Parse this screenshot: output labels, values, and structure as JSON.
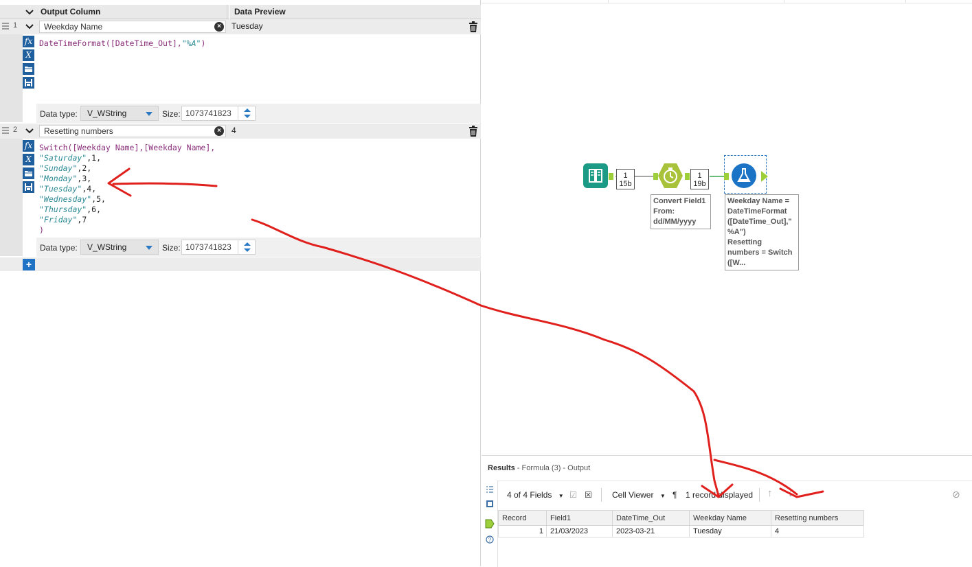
{
  "formula_panel": {
    "headers": {
      "output_column": "Output Column",
      "data_preview": "Data Preview"
    },
    "expressions": [
      {
        "index": "1",
        "name": "Weekday Name",
        "preview": "Tuesday",
        "code": [
          [
            [
              "fn",
              "DateTimeFormat("
            ],
            [
              "fn",
              "[DateTime_Out]"
            ],
            [
              "fn",
              ","
            ],
            [
              "str",
              "\"%A\""
            ],
            [
              "fn",
              ")"
            ]
          ]
        ],
        "data_type_label": "Data type:",
        "data_type": "V_WString",
        "size_label": "Size:",
        "size": "1073741823"
      },
      {
        "index": "2",
        "name": "Resetting numbers",
        "preview": "4",
        "code": [
          [
            [
              "fn",
              "Switch("
            ],
            [
              "fn",
              "[Weekday Name]"
            ],
            [
              "fn",
              ","
            ],
            [
              "fn",
              "[Weekday Name]"
            ],
            [
              "fn",
              ","
            ]
          ],
          [
            [
              "str",
              "\"Saturday\""
            ],
            [
              "txt",
              ",1,"
            ]
          ],
          [
            [
              "str",
              "\"Sunday\""
            ],
            [
              "txt",
              ",2,"
            ]
          ],
          [
            [
              "str",
              "\"Monday\""
            ],
            [
              "txt",
              ",3,"
            ]
          ],
          [
            [
              "str",
              "\"Tuesday\""
            ],
            [
              "txt",
              ",4,"
            ]
          ],
          [
            [
              "str",
              "\"Wednesday\""
            ],
            [
              "txt",
              ",5,"
            ]
          ],
          [
            [
              "str",
              "\"Thursday\""
            ],
            [
              "txt",
              ",6,"
            ]
          ],
          [
            [
              "str",
              "\"Friday\""
            ],
            [
              "txt",
              ",7"
            ]
          ],
          [
            [
              "fn",
              ")"
            ]
          ]
        ],
        "data_type_label": "Data type:",
        "data_type": "V_WString",
        "size_label": "Size:",
        "size": "1073741823"
      }
    ],
    "add_label": "+"
  },
  "canvas": {
    "nodes": [
      {
        "name": "input",
        "count_top": "1",
        "count_bottom": "15b"
      },
      {
        "name": "datetime",
        "count_top": "1",
        "count_bottom": "19b",
        "note": "Convert Field1\nFrom:\ndd/MM/yyyy"
      },
      {
        "name": "formula",
        "note": "Weekday Name =\nDateTimeFormat\n([DateTime_Out],\"\n%A\")\nResetting\nnumbers = Switch\n([W..."
      }
    ]
  },
  "results": {
    "title": "Results",
    "subtitle": "- Formula (3) - Output",
    "fields_label": "4 of 4 Fields",
    "cell_viewer": "Cell Viewer",
    "pilcrow": "¶",
    "records_label": "1 record displayed",
    "columns": [
      "Record",
      "Field1",
      "DateTime_Out",
      "Weekday Name",
      "Resetting numbers"
    ],
    "rows": [
      [
        "1",
        "21/03/2023",
        "2023-03-21",
        "Tuesday",
        "4"
      ]
    ]
  },
  "colors": {
    "annotation_red": "#e0201c",
    "accent_blue": "#1f5f9e",
    "input_teal": "#1b9a86",
    "datetime_green": "#a8c23a",
    "formula_blue": "#1b73c6"
  }
}
